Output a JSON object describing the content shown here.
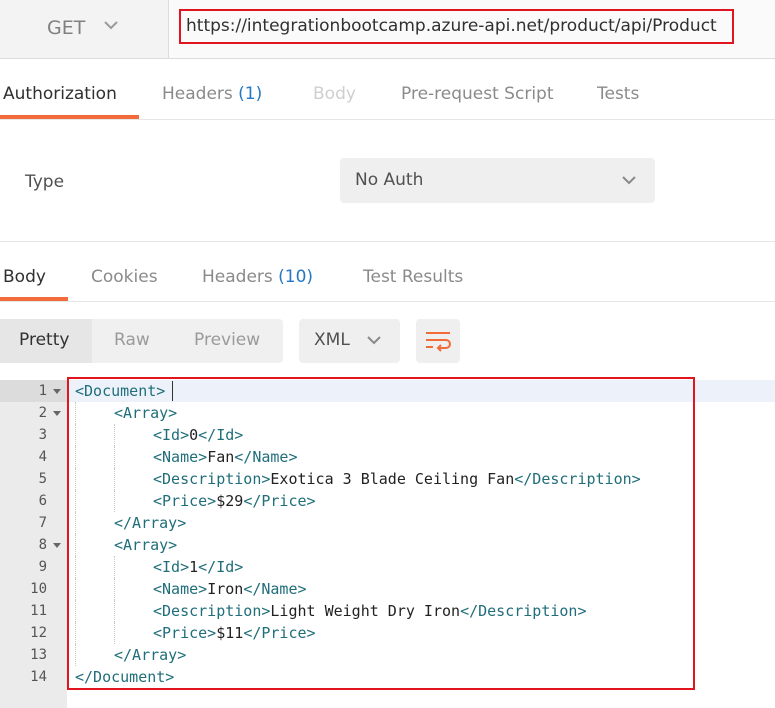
{
  "request": {
    "method": "GET",
    "url": "https://integrationbootcamp.azure-api.net/product/api/Product"
  },
  "request_tabs": [
    {
      "label": "Authorization",
      "count": "",
      "state": "active"
    },
    {
      "label": "Headers",
      "count": "(1)",
      "state": "normal"
    },
    {
      "label": "Body",
      "count": "",
      "state": "disabled"
    },
    {
      "label": "Pre-request Script",
      "count": "",
      "state": "normal"
    },
    {
      "label": "Tests",
      "count": "",
      "state": "normal"
    }
  ],
  "auth": {
    "type_label": "Type",
    "type_value": "No Auth"
  },
  "response_tabs": [
    {
      "label": "Body",
      "count": "",
      "state": "active"
    },
    {
      "label": "Cookies",
      "count": "",
      "state": "normal"
    },
    {
      "label": "Headers",
      "count": "(10)",
      "state": "normal"
    },
    {
      "label": "Test Results",
      "count": "",
      "state": "normal"
    }
  ],
  "view_modes": [
    {
      "label": "Pretty",
      "state": "active"
    },
    {
      "label": "Raw",
      "state": "normal"
    },
    {
      "label": "Preview",
      "state": "normal"
    }
  ],
  "format": {
    "value": "XML"
  },
  "wrap_icon": "word-wrap-icon",
  "editor": {
    "lines": [
      {
        "n": "1",
        "fold": true,
        "indent": 0,
        "parts": [
          [
            "tag",
            "<Document>"
          ]
        ]
      },
      {
        "n": "2",
        "fold": true,
        "indent": 1,
        "parts": [
          [
            "tag",
            "<Array>"
          ]
        ]
      },
      {
        "n": "3",
        "fold": false,
        "indent": 2,
        "parts": [
          [
            "tag",
            "<Id>"
          ],
          [
            "text",
            "0"
          ],
          [
            "tag",
            "</Id>"
          ]
        ]
      },
      {
        "n": "4",
        "fold": false,
        "indent": 2,
        "parts": [
          [
            "tag",
            "<Name>"
          ],
          [
            "text",
            "Fan"
          ],
          [
            "tag",
            "</Name>"
          ]
        ]
      },
      {
        "n": "5",
        "fold": false,
        "indent": 2,
        "parts": [
          [
            "tag",
            "<Description>"
          ],
          [
            "text",
            "Exotica 3 Blade Ceiling Fan"
          ],
          [
            "tag",
            "</Description>"
          ]
        ]
      },
      {
        "n": "6",
        "fold": false,
        "indent": 2,
        "parts": [
          [
            "tag",
            "<Price>"
          ],
          [
            "text",
            "$29"
          ],
          [
            "tag",
            "</Price>"
          ]
        ]
      },
      {
        "n": "7",
        "fold": false,
        "indent": 1,
        "parts": [
          [
            "tag",
            "</Array>"
          ]
        ]
      },
      {
        "n": "8",
        "fold": true,
        "indent": 1,
        "parts": [
          [
            "tag",
            "<Array>"
          ]
        ]
      },
      {
        "n": "9",
        "fold": false,
        "indent": 2,
        "parts": [
          [
            "tag",
            "<Id>"
          ],
          [
            "text",
            "1"
          ],
          [
            "tag",
            "</Id>"
          ]
        ]
      },
      {
        "n": "10",
        "fold": false,
        "indent": 2,
        "parts": [
          [
            "tag",
            "<Name>"
          ],
          [
            "text",
            "Iron"
          ],
          [
            "tag",
            "</Name>"
          ]
        ]
      },
      {
        "n": "11",
        "fold": false,
        "indent": 2,
        "parts": [
          [
            "tag",
            "<Description>"
          ],
          [
            "text",
            "Light Weight Dry Iron"
          ],
          [
            "tag",
            "</Description>"
          ]
        ]
      },
      {
        "n": "12",
        "fold": false,
        "indent": 2,
        "parts": [
          [
            "tag",
            "<Price>"
          ],
          [
            "text",
            "$11"
          ],
          [
            "tag",
            "</Price>"
          ]
        ]
      },
      {
        "n": "13",
        "fold": false,
        "indent": 1,
        "parts": [
          [
            "tag",
            "</Array>"
          ]
        ]
      },
      {
        "n": "14",
        "fold": false,
        "indent": 0,
        "parts": [
          [
            "tag",
            "</Document>"
          ]
        ]
      }
    ]
  },
  "colors": {
    "accent": "#f26b3a",
    "highlight_box": "#e0151f",
    "count_blue": "#2478c6",
    "xml_tag": "#1f6e7a"
  }
}
